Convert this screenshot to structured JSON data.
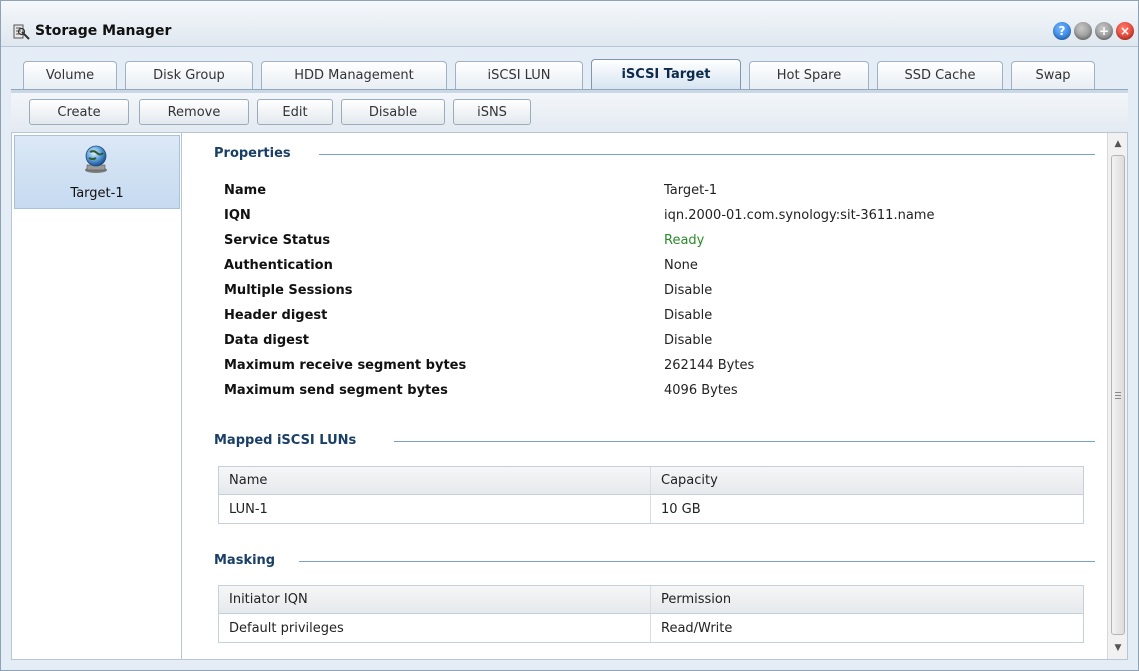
{
  "window": {
    "title": "Storage Manager",
    "buttons": {
      "help": "?",
      "minimize": "",
      "maximize": "+",
      "close": "×"
    }
  },
  "tabs": [
    {
      "label": "Volume",
      "active": false
    },
    {
      "label": "Disk Group",
      "active": false
    },
    {
      "label": "HDD Management",
      "active": false
    },
    {
      "label": "iSCSI LUN",
      "active": false
    },
    {
      "label": "iSCSI Target",
      "active": true
    },
    {
      "label": "Hot Spare",
      "active": false
    },
    {
      "label": "SSD Cache",
      "active": false
    },
    {
      "label": "Swap",
      "active": false
    }
  ],
  "toolbar": {
    "create": "Create",
    "remove": "Remove",
    "edit": "Edit",
    "disable": "Disable",
    "isns": "iSNS"
  },
  "targets": [
    {
      "label": "Target-1",
      "icon": "globe-icon",
      "selected": true
    }
  ],
  "properties": {
    "title": "Properties",
    "rows": [
      {
        "label": "Name",
        "value": "Target-1"
      },
      {
        "label": "IQN",
        "value": "iqn.2000-01.com.synology:sit-3611.name"
      },
      {
        "label": "Service Status",
        "value": "Ready"
      },
      {
        "label": "Authentication",
        "value": "None"
      },
      {
        "label": "Multiple Sessions",
        "value": "Disable"
      },
      {
        "label": "Header digest",
        "value": "Disable"
      },
      {
        "label": "Data digest",
        "value": "Disable"
      },
      {
        "label": "Maximum receive segment bytes",
        "value": "262144 Bytes"
      },
      {
        "label": "Maximum send segment bytes",
        "value": "4096 Bytes"
      }
    ]
  },
  "mapped_luns": {
    "title": "Mapped iSCSI LUNs",
    "headers": [
      "Name",
      "Capacity"
    ],
    "rows": [
      [
        "LUN-1",
        "10 GB"
      ]
    ]
  },
  "masking": {
    "title": "Masking",
    "headers": [
      "Initiator IQN",
      "Permission"
    ],
    "rows": [
      [
        "Default privileges",
        "Read/Write"
      ]
    ]
  },
  "colors": {
    "ready": "#2a8a2a",
    "section_title": "#1a3f66",
    "accent": "#7aa2c8"
  }
}
